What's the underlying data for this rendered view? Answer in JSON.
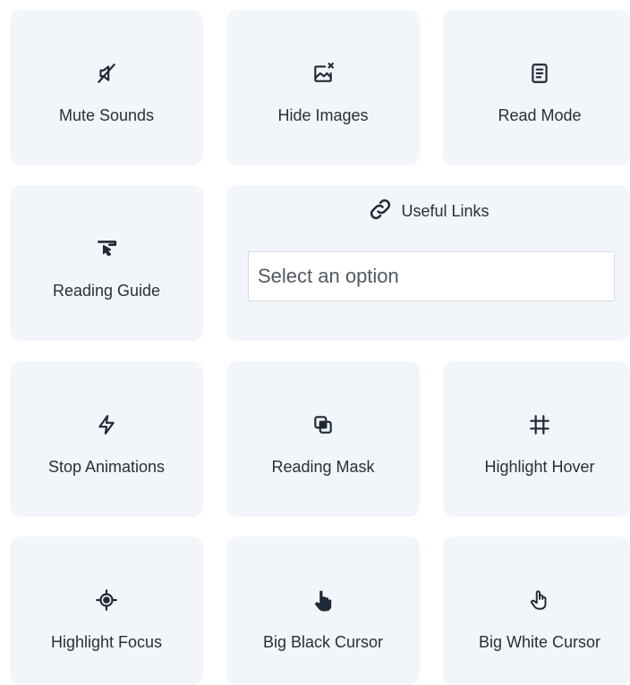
{
  "tools": {
    "mute_sounds": {
      "label": "Mute Sounds",
      "icon": "mute-sound-icon"
    },
    "hide_images": {
      "label": "Hide Images",
      "icon": "hide-image-icon"
    },
    "read_mode": {
      "label": "Read Mode",
      "icon": "document-icon"
    },
    "reading_guide": {
      "label": "Reading Guide",
      "icon": "reading-guide-icon"
    },
    "useful_links": {
      "label": "Useful Links",
      "icon": "link-icon",
      "select_placeholder": "Select an option"
    },
    "stop_animations": {
      "label": "Stop Animations",
      "icon": "lightning-bolt-icon"
    },
    "reading_mask": {
      "label": "Reading Mask",
      "icon": "mask-layers-icon"
    },
    "highlight_hover": {
      "label": "Highlight Hover",
      "icon": "hashtag-icon"
    },
    "highlight_focus": {
      "label": "Highlight Focus",
      "icon": "crosshair-icon"
    },
    "big_black_cursor": {
      "label": "Big Black Cursor",
      "icon": "black-hand-cursor-icon"
    },
    "big_white_cursor": {
      "label": "Big White Cursor",
      "icon": "white-hand-cursor-icon"
    }
  },
  "colors": {
    "card_background": "#f2f6fa",
    "icon": "#1f2937",
    "text": "#2b2f36"
  }
}
